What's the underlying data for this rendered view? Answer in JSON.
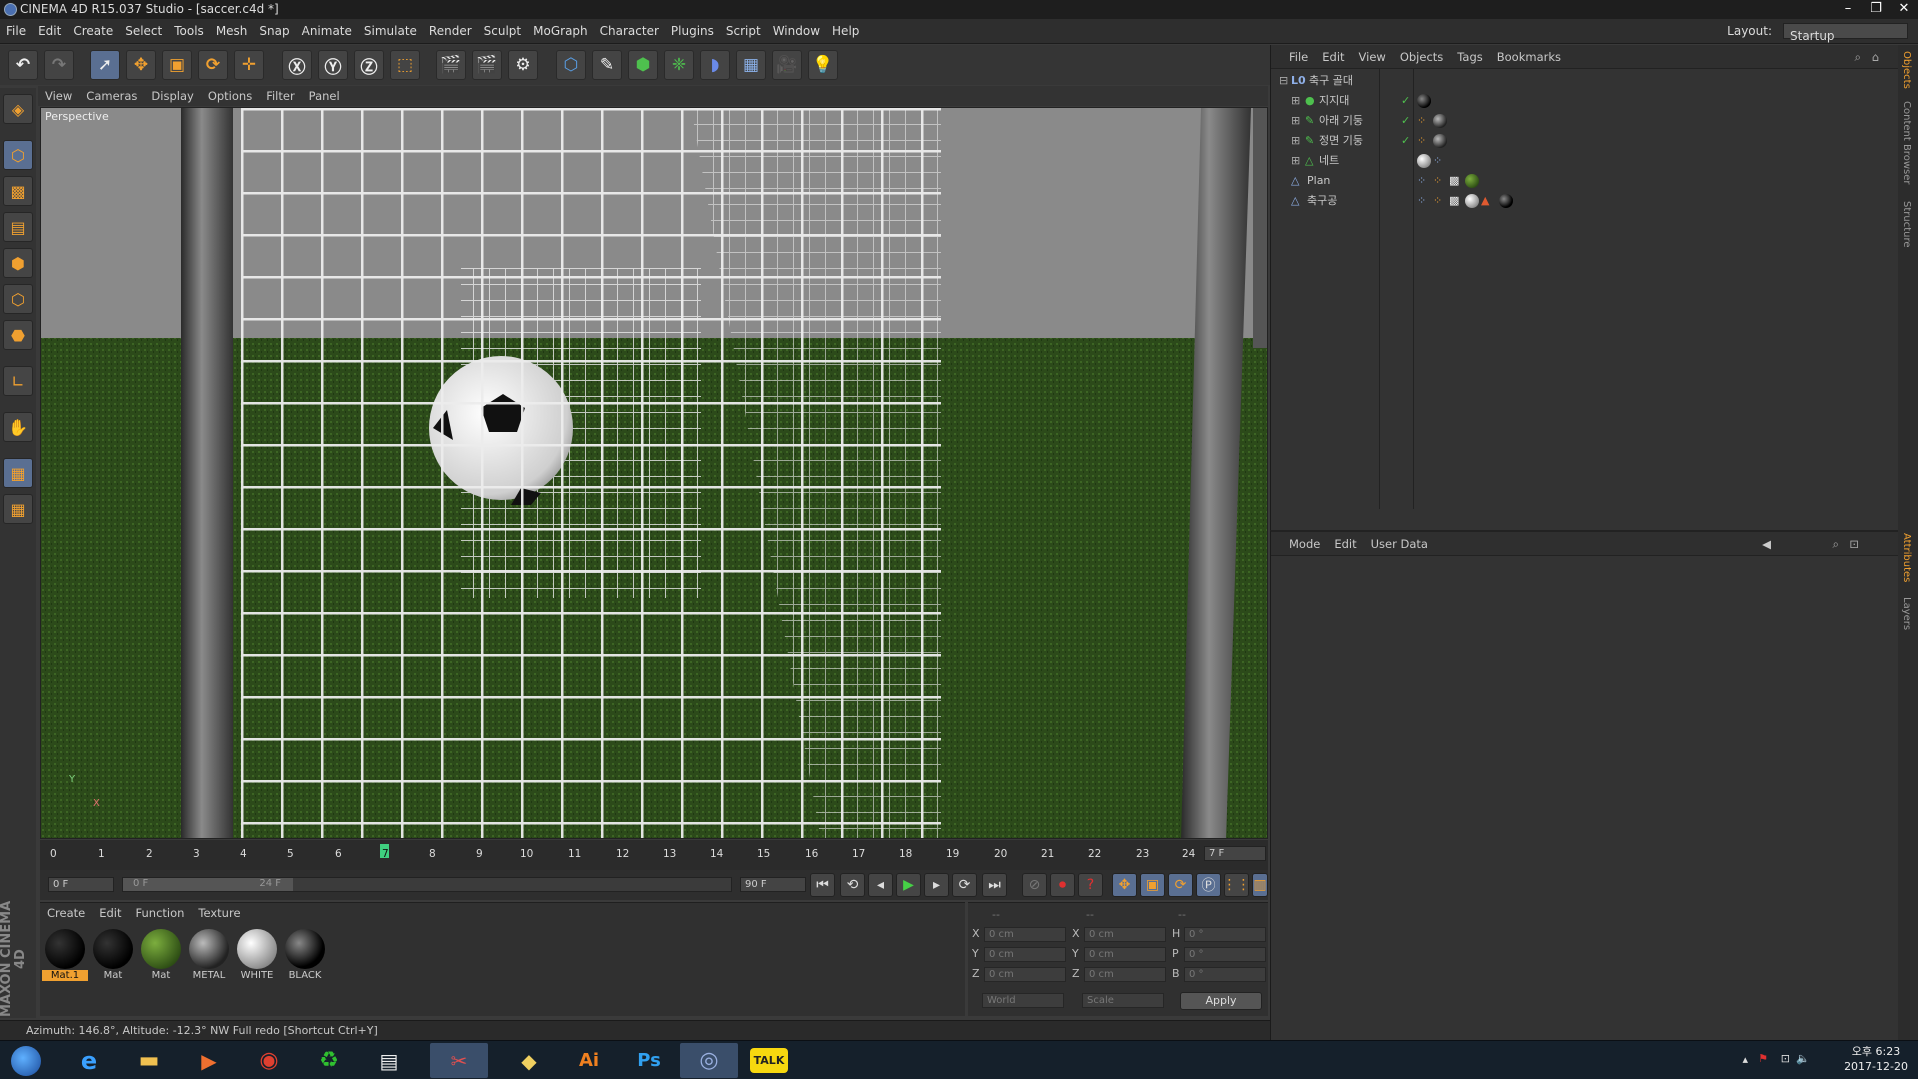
{
  "window": {
    "title": "CINEMA 4D R15.037 Studio - [saccer.c4d *]",
    "min": "–",
    "max": "❐",
    "close": "✕"
  },
  "menu": [
    "File",
    "Edit",
    "Create",
    "Select",
    "Tools",
    "Mesh",
    "Snap",
    "Animate",
    "Simulate",
    "Render",
    "Sculpt",
    "MoGraph",
    "Character",
    "Plugins",
    "Script",
    "Window",
    "Help"
  ],
  "layout": {
    "label": "Layout:",
    "value": "Startup"
  },
  "viewport": {
    "menu": [
      "View",
      "Cameras",
      "Display",
      "Options",
      "Filter",
      "Panel"
    ],
    "label": "Perspective",
    "axis_y": "Y",
    "axis_x": "X"
  },
  "timeline": {
    "ticks": [
      "0",
      "1",
      "2",
      "3",
      "4",
      "5",
      "6",
      "7",
      "8",
      "9",
      "10",
      "11",
      "12",
      "13",
      "14",
      "15",
      "16",
      "17",
      "18",
      "19",
      "20",
      "21",
      "22",
      "23",
      "24"
    ],
    "current_frame_label": "7 F",
    "current_frame": 7,
    "start_field": "0 F",
    "range_start": "0 F",
    "range_end": "24 F",
    "end_field": "90 F"
  },
  "materials": {
    "menu": [
      "Create",
      "Edit",
      "Function",
      "Texture"
    ],
    "items": [
      {
        "name": "Mat.1",
        "color": "#050505",
        "selected": true
      },
      {
        "name": "Mat",
        "color": "#050505",
        "selected": false
      },
      {
        "name": "Mat",
        "color": "#3e6b1a",
        "selected": false
      },
      {
        "name": "METAL",
        "color": "#3a3a3a",
        "selected": false
      },
      {
        "name": "WHITE",
        "color": "#bdbdbd",
        "selected": false
      },
      {
        "name": "BLACK",
        "color": "#0a0a0a",
        "selected": false
      }
    ]
  },
  "coords": {
    "headers": [
      "--",
      "--",
      "--"
    ],
    "rows": [
      {
        "a": "X",
        "v1": "0 cm",
        "b": "X",
        "v2": "0 cm",
        "c": "H",
        "v3": "0 °"
      },
      {
        "a": "Y",
        "v1": "0 cm",
        "b": "Y",
        "v2": "0 cm",
        "c": "P",
        "v3": "0 °"
      },
      {
        "a": "Z",
        "v1": "0 cm",
        "b": "Z",
        "v2": "0 cm",
        "c": "B",
        "v3": "0 °"
      }
    ],
    "space": "World",
    "mode": "Scale",
    "apply": "Apply"
  },
  "status": {
    "text": "Azimuth: 146.8°, Altitude: -12.3°  NW     Full redo [Shortcut Ctrl+Y]"
  },
  "branding": "MAXON CINEMA 4D",
  "objects": {
    "menu": [
      "File",
      "Edit",
      "View",
      "Objects",
      "Tags",
      "Bookmarks"
    ],
    "items": [
      {
        "name": "축구 골대",
        "indent": 0
      },
      {
        "name": "지지대",
        "indent": 1
      },
      {
        "name": "아래 기둥",
        "indent": 1
      },
      {
        "name": "정면 기둥",
        "indent": 1
      },
      {
        "name": "네트",
        "indent": 1
      },
      {
        "name": "Plan",
        "indent": 0
      },
      {
        "name": "축구공",
        "indent": 0
      }
    ]
  },
  "attributes": {
    "menu": [
      "Mode",
      "Edit",
      "User Data"
    ]
  },
  "side_tabs": [
    "Objects",
    "Content Browser",
    "Structure",
    "Attributes",
    "Layers"
  ],
  "taskbar": {
    "time": "오후 6:23",
    "date": "2017-12-20"
  }
}
